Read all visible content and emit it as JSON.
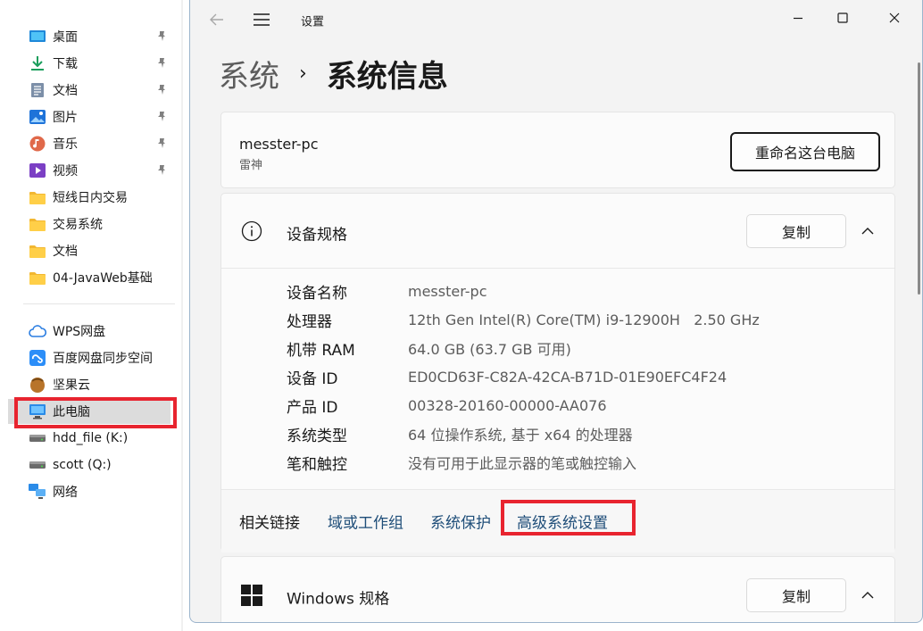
{
  "explorer": {
    "pinned": [
      {
        "label": "桌面",
        "icon": "desktop-icon",
        "pinned": true
      },
      {
        "label": "下载",
        "icon": "download-icon",
        "pinned": true
      },
      {
        "label": "文档",
        "icon": "document-icon",
        "pinned": true
      },
      {
        "label": "图片",
        "icon": "picture-icon",
        "pinned": true
      },
      {
        "label": "音乐",
        "icon": "music-icon",
        "pinned": true
      },
      {
        "label": "视频",
        "icon": "video-icon",
        "pinned": true
      },
      {
        "label": "短线日内交易",
        "icon": "folder-icon",
        "pinned": false
      },
      {
        "label": "交易系统",
        "icon": "folder-icon",
        "pinned": false
      },
      {
        "label": "文档",
        "icon": "folder-icon",
        "pinned": false
      },
      {
        "label": "04-JavaWeb基础",
        "icon": "folder-icon",
        "pinned": false
      }
    ],
    "locations": [
      {
        "label": "WPS网盘",
        "icon": "cloud-icon"
      },
      {
        "label": "百度网盘同步空间",
        "icon": "baidu-netdisk-icon"
      },
      {
        "label": "坚果云",
        "icon": "nut-cloud-icon"
      },
      {
        "label": "此电脑",
        "icon": "computer-icon",
        "selected": true
      },
      {
        "label": "hdd_file (K:)",
        "icon": "drive-icon"
      },
      {
        "label": "scott (Q:)",
        "icon": "drive-icon"
      },
      {
        "label": "网络",
        "icon": "network-icon"
      }
    ]
  },
  "settings": {
    "window_title": "设置",
    "breadcrumb": {
      "parent": "系统",
      "separator": "›",
      "current": "系统信息"
    },
    "device": {
      "name": "messter-pc",
      "subtitle": "雷神",
      "rename_label": "重命名这台电脑"
    },
    "device_specs": {
      "title": "设备规格",
      "copy_label": "复制",
      "rows": [
        {
          "label": "设备名称",
          "value": "messter-pc"
        },
        {
          "label": "处理器",
          "value": "12th Gen Intel(R) Core(TM) i9-12900H   2.50 GHz"
        },
        {
          "label": "机带 RAM",
          "value": "64.0 GB (63.7 GB 可用)"
        },
        {
          "label": "设备 ID",
          "value": "ED0CD63F-C82A-42CA-B71D-01E90EFC4F24"
        },
        {
          "label": "产品 ID",
          "value": "00328-20160-00000-AA076"
        },
        {
          "label": "系统类型",
          "value": "64 位操作系统, 基于 x64 的处理器"
        },
        {
          "label": "笔和触控",
          "value": "没有可用于此显示器的笔或触控输入"
        }
      ],
      "related_label": "相关链接",
      "related_links": [
        "域或工作组",
        "系统保护",
        "高级系统设置"
      ]
    },
    "windows_specs": {
      "title": "Windows 规格",
      "copy_label": "复制"
    }
  },
  "colors": {
    "highlight_box": "#e8242f",
    "link": "#1f4e79",
    "selected_bg": "#dcdcdc"
  }
}
